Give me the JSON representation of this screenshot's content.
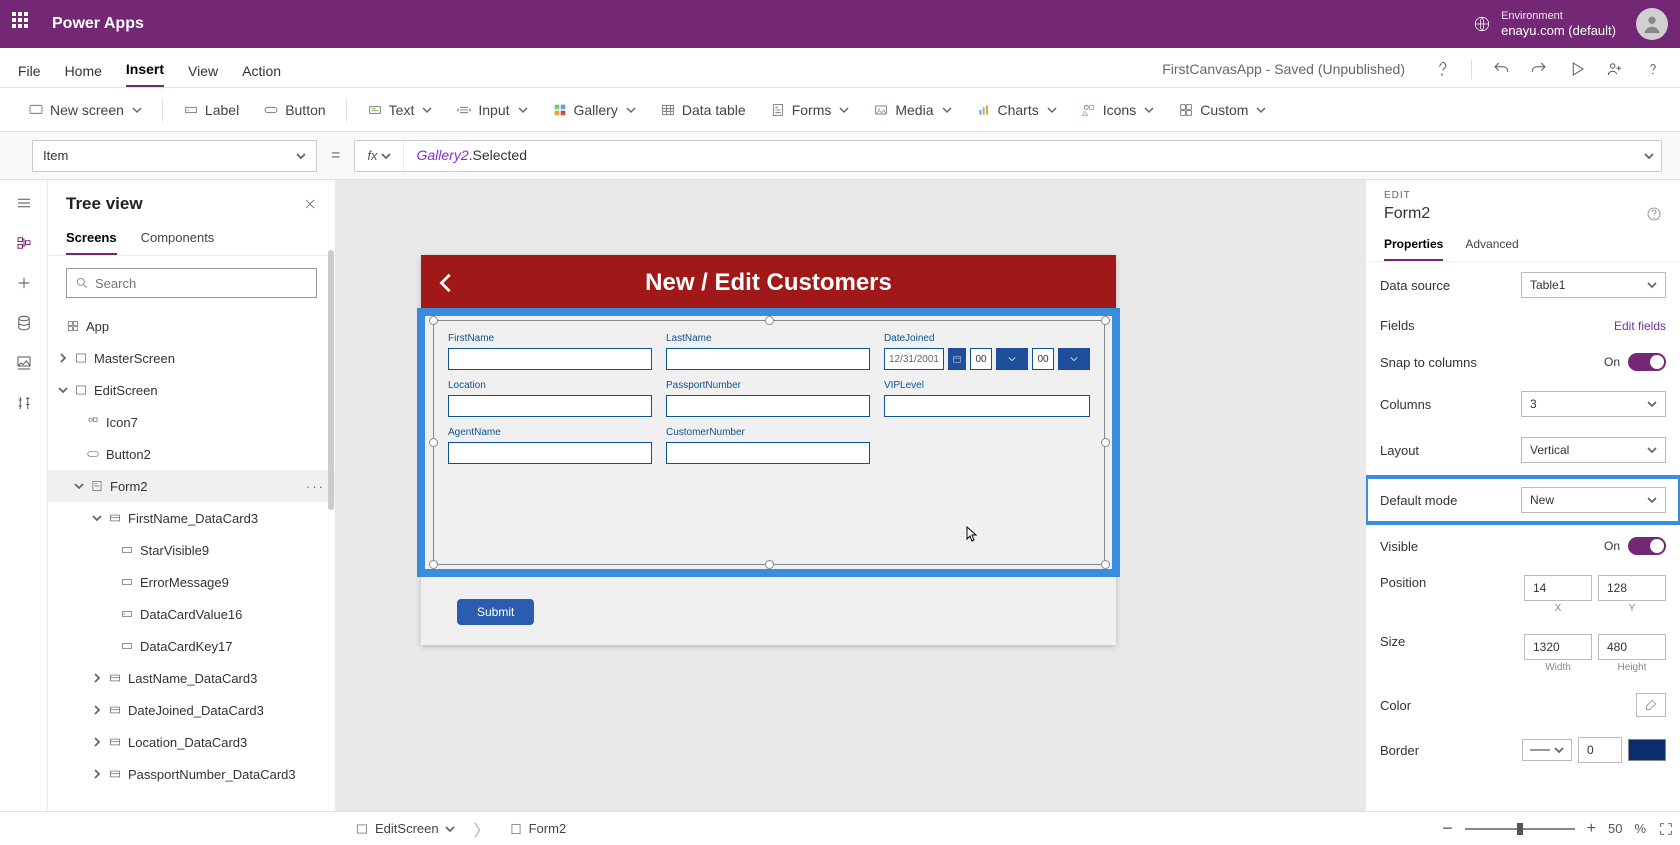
{
  "titlebar": {
    "brand": "Power Apps",
    "env_label": "Environment",
    "env_name": "enayu.com (default)"
  },
  "menubar": {
    "items": [
      "File",
      "Home",
      "Insert",
      "View",
      "Action"
    ],
    "active_index": 2,
    "status": "FirstCanvasApp - Saved (Unpublished)"
  },
  "ribbon": {
    "new_screen": "New screen",
    "label": "Label",
    "button": "Button",
    "text": "Text",
    "input": "Input",
    "gallery": "Gallery",
    "data_table": "Data table",
    "forms": "Forms",
    "media": "Media",
    "charts": "Charts",
    "icons": "Icons",
    "custom": "Custom"
  },
  "formula": {
    "property": "Item",
    "fx": "fx",
    "obj": "Gallery2",
    "suffix": ".Selected"
  },
  "tree": {
    "title": "Tree view",
    "tabs": [
      "Screens",
      "Components"
    ],
    "active_tab": 0,
    "search_placeholder": "Search",
    "nodes": {
      "app": "App",
      "master": "MasterScreen",
      "edit": "EditScreen",
      "icon7": "Icon7",
      "button2": "Button2",
      "form2": "Form2",
      "fn_dc": "FirstName_DataCard3",
      "star9": "StarVisible9",
      "err9": "ErrorMessage9",
      "dcv16": "DataCardValue16",
      "dck17": "DataCardKey17",
      "ln_dc": "LastName_DataCard3",
      "dj_dc": "DateJoined_DataCard3",
      "loc_dc": "Location_DataCard3",
      "pn_dc": "PassportNumber_DataCard3"
    }
  },
  "canvas": {
    "header_title": "New / Edit Customers",
    "submit": "Submit",
    "fields": {
      "first": "FirstName",
      "last": "LastName",
      "date": "DateJoined",
      "loc": "Location",
      "pass": "PassportNumber",
      "vip": "VIPLevel",
      "agent": "AgentName",
      "cust": "CustomerNumber",
      "date_value": "12/31/2001",
      "hh": "00",
      "mm": "00"
    }
  },
  "props": {
    "edit": "EDIT",
    "name": "Form2",
    "tabs": [
      "Properties",
      "Advanced"
    ],
    "active_tab": 0,
    "data_source_lbl": "Data source",
    "data_source_val": "Table1",
    "fields_lbl": "Fields",
    "edit_fields": "Edit fields",
    "snap_lbl": "Snap to columns",
    "on": "On",
    "columns_lbl": "Columns",
    "columns_val": "3",
    "layout_lbl": "Layout",
    "layout_val": "Vertical",
    "default_mode_lbl": "Default mode",
    "default_mode_val": "New",
    "visible_lbl": "Visible",
    "position_lbl": "Position",
    "pos_x": "14",
    "pos_y": "128",
    "x_lbl": "X",
    "y_lbl": "Y",
    "size_lbl": "Size",
    "w": "1320",
    "h": "480",
    "w_lbl": "Width",
    "h_lbl": "Height",
    "color_lbl": "Color",
    "border_lbl": "Border",
    "border_val": "0"
  },
  "statusbar": {
    "bc1": "EditScreen",
    "bc2": "Form2",
    "zoom_minus": "−",
    "zoom_plus": "+",
    "zoom_val": "50",
    "zoom_pct": "%"
  }
}
